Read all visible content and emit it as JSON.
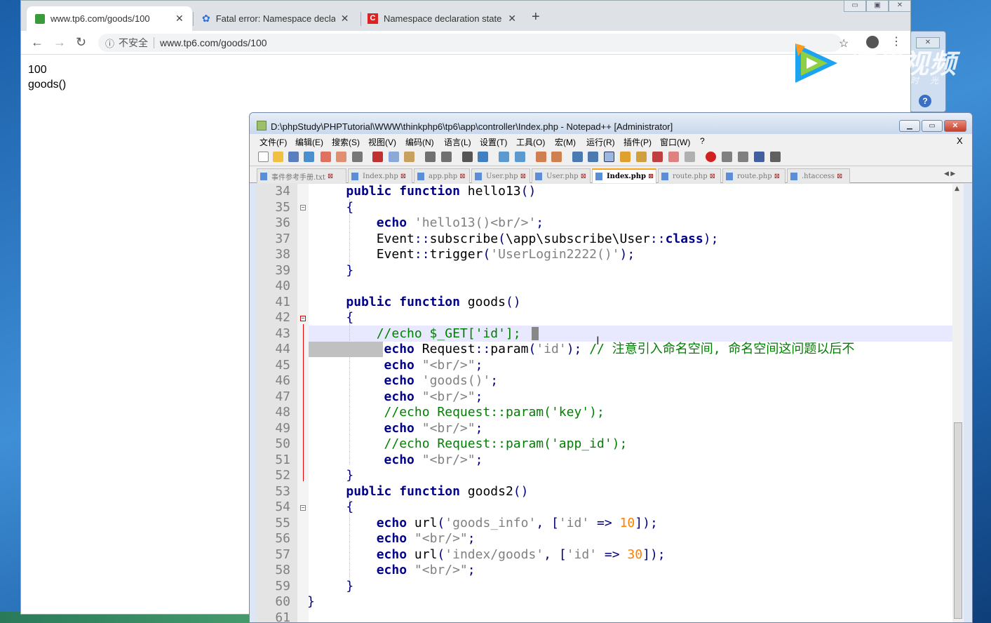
{
  "browser": {
    "tabs": [
      {
        "title": "www.tp6.com/goods/100",
        "icon": "leaf-icon",
        "active": true
      },
      {
        "title": "Fatal error: Namespace declar",
        "icon": "paw-icon",
        "active": false
      },
      {
        "title": "Namespace declaration staten",
        "icon": "c-logo-icon",
        "active": false
      }
    ],
    "new_tab_label": "+",
    "address": {
      "security_label": "不安全",
      "url": "www.tp6.com/goods/100"
    },
    "page_lines": [
      "100",
      "goods()"
    ]
  },
  "watermark": {
    "brand": "腾讯视频",
    "slogan": "不负好时光"
  },
  "notepad": {
    "title": "D:\\phpStudy\\PHPTutorial\\WWW\\thinkphp6\\tp6\\app\\controller\\Index.php - Notepad++ [Administrator]",
    "menu": [
      "文件(F)",
      "编辑(E)",
      "搜索(S)",
      "视图(V)",
      "编码(N)",
      "语言(L)",
      "设置(T)",
      "工具(O)",
      "宏(M)",
      "运行(R)",
      "插件(P)",
      "窗口(W)",
      "?"
    ],
    "menu_close": "X",
    "file_tabs": [
      {
        "name": "事件参考手册.txt",
        "active": false
      },
      {
        "name": "Index.php",
        "active": false
      },
      {
        "name": "app.php",
        "active": false
      },
      {
        "name": "User.php",
        "active": false
      },
      {
        "name": "User.php",
        "active": false
      },
      {
        "name": "Index.php",
        "active": true
      },
      {
        "name": "route.php",
        "active": false
      },
      {
        "name": "route.php",
        "active": false
      },
      {
        "name": ".htaccess",
        "active": false
      }
    ],
    "line_numbers": [
      "34",
      "35",
      "36",
      "37",
      "38",
      "39",
      "40",
      "41",
      "42",
      "43",
      "44",
      "45",
      "46",
      "47",
      "48",
      "49",
      "50",
      "51",
      "52",
      "53",
      "54",
      "55",
      "56",
      "57",
      "58",
      "59",
      "60",
      "61"
    ]
  },
  "colors": {
    "keyword": "#00008b",
    "string": "#808080",
    "comment": "#008000",
    "number": "#ff8000",
    "fold_marker": "#e00000",
    "active_tab_accent": "#f7a41d"
  }
}
